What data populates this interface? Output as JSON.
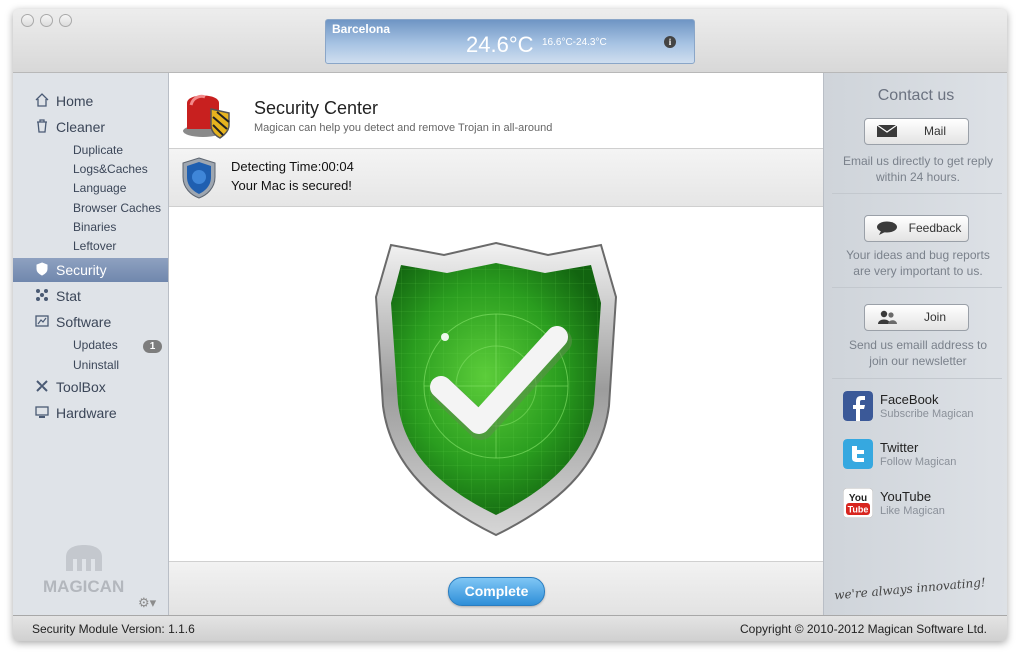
{
  "weather": {
    "city": "Barcelona",
    "temperature": "24.6°C",
    "range": "16.6°C-24.3°C",
    "info_icon": "i"
  },
  "sidebar": {
    "items": [
      {
        "label": "Home",
        "icon": "home-icon"
      },
      {
        "label": "Cleaner",
        "icon": "trash-icon"
      },
      {
        "label": "Security",
        "icon": "shield-icon"
      },
      {
        "label": "Stat",
        "icon": "stat-icon"
      },
      {
        "label": "Software",
        "icon": "software-icon"
      },
      {
        "label": "ToolBox",
        "icon": "toolbox-icon"
      },
      {
        "label": "Hardware",
        "icon": "hardware-icon"
      }
    ],
    "cleaner_sub": [
      "Duplicate",
      "Logs&Caches",
      "Language",
      "Browser Caches",
      "Binaries",
      "Leftover"
    ],
    "software_sub": [
      "Updates",
      "Uninstall"
    ],
    "updates_badge": "1",
    "logo_text": "MAGICAN",
    "gear_glyph": "⚙▾"
  },
  "main": {
    "title": "Security Center",
    "subtitle": "Magican can help you detect and remove Trojan in all-around",
    "detecting_time": "Detecting Time:00:04",
    "status_message": "Your Mac is secured!",
    "complete_label": "Complete"
  },
  "contact": {
    "title": "Contact us",
    "mail_label": "Mail",
    "mail_desc": "Email us directly to get reply within 24 hours.",
    "feedback_label": "Feedback",
    "feedback_desc": "Your ideas and bug reports are very important to us.",
    "join_label": "Join",
    "join_desc": "Send us emaill address to join our newsletter",
    "social": [
      {
        "name": "FaceBook",
        "sub": "Subscribe Magican",
        "icon": "facebook-icon"
      },
      {
        "name": "Twitter",
        "sub": "Follow Magican",
        "icon": "twitter-icon"
      },
      {
        "name": "YouTube",
        "sub": "Like Magican",
        "icon": "youtube-icon"
      }
    ],
    "slogan": "we're always innovating!"
  },
  "statusline": {
    "version": "Security Module Version: 1.1.6",
    "copyright": "Copyright © 2010-2012 Magican Software Ltd."
  },
  "colors": {
    "active_nav": "#7a8fb5",
    "complete_button": "#3a96dc",
    "shield_green": "#2a9d1f"
  }
}
